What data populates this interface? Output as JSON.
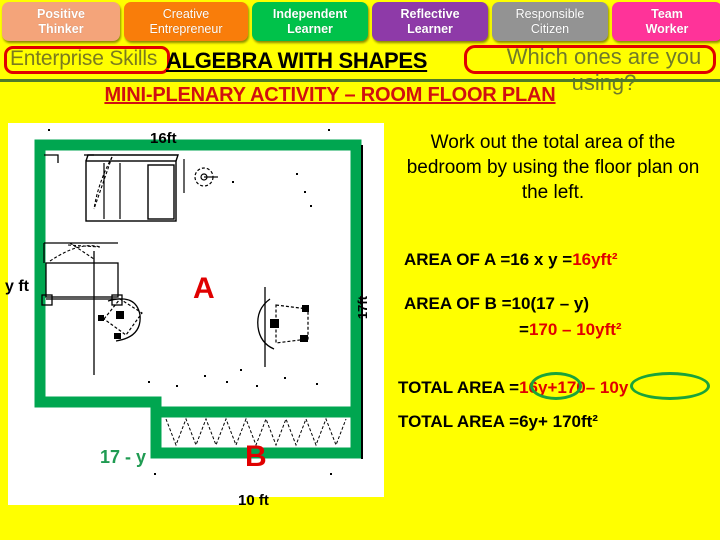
{
  "skills_bar": {
    "items": [
      {
        "line1": "Positive",
        "line2": "Thinker",
        "color": "#f4a47a"
      },
      {
        "line1": "Creative",
        "line2": "Entrepreneur",
        "color": "#f97d0a"
      },
      {
        "line1": "Independent",
        "line2": "Learner",
        "color": "#00c24a"
      },
      {
        "line1": "Reflective",
        "line2": "Learner",
        "color": "#8e3aa8"
      },
      {
        "line1": "Responsible",
        "line2": "Citizen",
        "color": "#939393"
      },
      {
        "line1": "Team",
        "line2": "Worker",
        "color": "#ff3399"
      }
    ]
  },
  "header": {
    "enterprise_label": "Enterprise Skills",
    "main_title": "ALGEBRA WITH SHAPES",
    "prompt": "Which ones are you using?",
    "subtitle": "MINI-PLENARY ACTIVITY – ROOM FLOOR PLAN"
  },
  "floor_plan": {
    "dim_top": "16ft",
    "dim_left": "y ft",
    "dim_right": "17ft",
    "dim_bottom": "10 ft",
    "label_17_minus_y": "17 - y",
    "room_a": "A",
    "room_b": "B"
  },
  "task": {
    "instruction": "Work out the total area of the bedroom by using the floor plan on the left."
  },
  "working": {
    "area_a_label": "AREA OF A =",
    "area_a_expr": "16 x y =",
    "area_a_result": "16yft²",
    "area_b_label": "AREA OF B =",
    "area_b_expr": "10(17 – y)",
    "area_b_eq": "=",
    "area_b_result": "170 – 10yft²",
    "total_label_1": "TOTAL AREA =",
    "total_term_1": "16y",
    "total_plus": "+",
    "total_term_2": "170",
    "total_term_3": "– 10y",
    "total_label_2": "TOTAL AREA =",
    "total_result": "6y+ 170ft²"
  },
  "colors": {
    "background": "#ffff00",
    "wall_green": "#00a650",
    "accent_red": "#e00000",
    "title_red": "#d01010",
    "olive": "#7b7b1e",
    "circle_green": "#1aa33a"
  }
}
